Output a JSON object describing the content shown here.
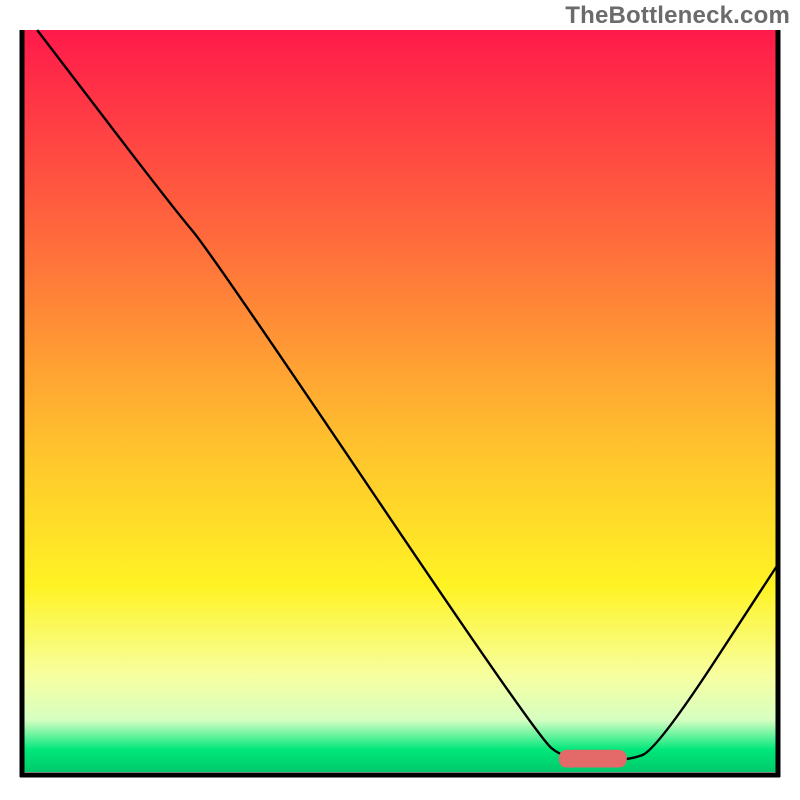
{
  "attribution": "TheBottleneck.com",
  "chart_data": {
    "type": "line",
    "title": "",
    "xlabel": "",
    "ylabel": "",
    "xlim": [
      0,
      100
    ],
    "ylim": [
      0,
      100
    ],
    "background_gradient": {
      "stops": [
        {
          "offset": 0,
          "color": "#ff1a4b"
        },
        {
          "offset": 28,
          "color": "#ff6a3c"
        },
        {
          "offset": 55,
          "color": "#ffbf2e"
        },
        {
          "offset": 75,
          "color": "#fff324"
        },
        {
          "offset": 87,
          "color": "#f7ffa0"
        },
        {
          "offset": 93,
          "color": "#d6ffc2"
        },
        {
          "offset": 97,
          "color": "#00e77a"
        },
        {
          "offset": 100,
          "color": "#00c96b"
        }
      ]
    },
    "series": [
      {
        "name": "bottleneck-curve",
        "color": "#000000",
        "stroke_width": 2.4,
        "points": [
          {
            "x": 2,
            "y": 100
          },
          {
            "x": 20,
            "y": 76
          },
          {
            "x": 25,
            "y": 70
          },
          {
            "x": 68,
            "y": 5
          },
          {
            "x": 72,
            "y": 1.5
          },
          {
            "x": 80,
            "y": 1.5
          },
          {
            "x": 84,
            "y": 3
          },
          {
            "x": 100,
            "y": 28
          }
        ]
      }
    ],
    "marker": {
      "name": "optimal-range",
      "color": "#e46a6a",
      "x_start": 71,
      "x_end": 80,
      "y": 1.8,
      "thickness": 2.4
    },
    "axes": {
      "left": true,
      "right": true,
      "top": false,
      "bottom": true,
      "color": "#000000",
      "width": 5
    }
  }
}
